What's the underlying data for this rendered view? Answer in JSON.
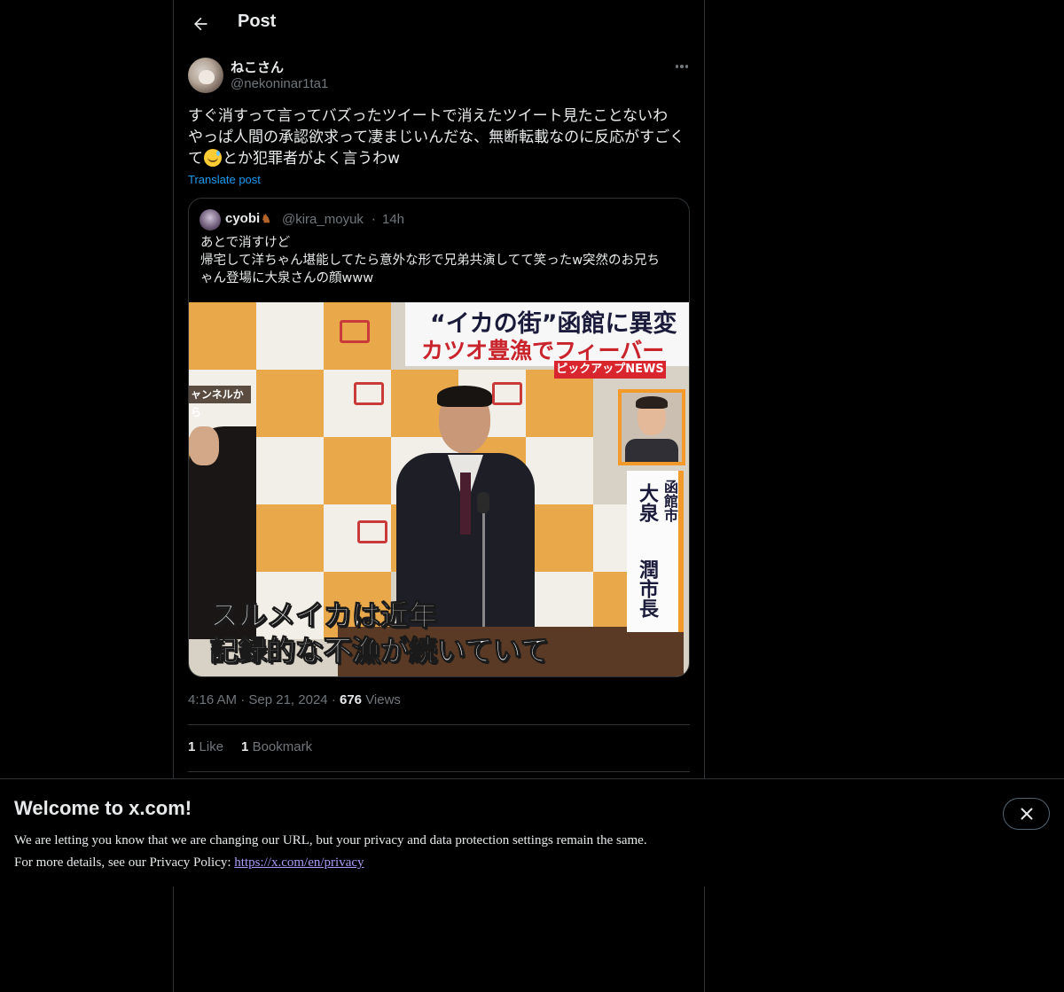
{
  "header": {
    "title": "Post"
  },
  "post": {
    "display_name": "ねこさん",
    "handle": "@nekoninar1ta1",
    "text_line1": "すぐ消すって言ってバズったツイートで消えたツイート見たことないわ",
    "text_line2": "やっぱ人間の承認欲求って凄まじいんだな、無断転載なのに反応がすごく",
    "text_line3_a": "て",
    "text_line3_b": "とか犯罪者がよく言うわw",
    "translate_label": "Translate post",
    "time": "4:16 AM",
    "date": "Sep 21, 2024",
    "views_count": "676",
    "views_label": "Views",
    "likes_count": "1",
    "likes_label": "Like",
    "bookmarks_count": "1",
    "bookmarks_label": "Bookmark"
  },
  "quote": {
    "display_name": "cyobi",
    "handle": "@kira_moyuk",
    "time": "14h",
    "text": "あとで消すけど\n帰宅して洋ちゃん堪能してたら意外な形で兄弟共演してて笑ったw突然のお兄ち\nゃん登場に大泉さんの顔www",
    "media": {
      "headline1": "“イカの街”函館に異変",
      "headline2": "カツオ豊漁でフィーバー",
      "pickup": "ピックアップNEWS",
      "channel": "ャンネルから",
      "name_city": "函館市",
      "name_family": "大泉",
      "name_given": "潤市長",
      "caption1": "スルメイカは近年",
      "caption2": "記録的な不漁が続いていて"
    }
  },
  "banner": {
    "title": "Welcome to x.com!",
    "line1": "We are letting you know that we are changing our URL, but your privacy and data protection settings remain the same.",
    "line2_prefix": "For more details, see our Privacy Policy: ",
    "link": "https://x.com/en/privacy"
  },
  "icons": {
    "back": "back-arrow-icon",
    "more": "more-icon",
    "close": "close-icon",
    "emoji": "grinning-sweat-emoji"
  },
  "colors": {
    "background": "#000000",
    "text": "#e7e9ea",
    "muted": "#71767b",
    "accent": "#1d9bf0",
    "border": "#2f3336",
    "link_visited": "#a99bf5"
  }
}
